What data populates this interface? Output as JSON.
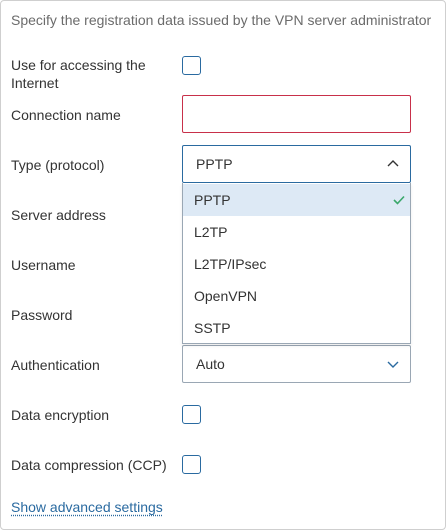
{
  "description": "Specify the registration data issued by the VPN server administrator",
  "form": {
    "internet_label": "Use for accessing the Internet",
    "connection_name_label": "Connection name",
    "connection_name_value": "",
    "type_label": "Type (protocol)",
    "type_value": "PPTP",
    "server_label": "Server address",
    "username_label": "Username",
    "password_label": "Password",
    "auth_label": "Authentication",
    "auth_value": "Auto",
    "encryption_label": "Data encryption",
    "compression_label": "Data compression (CCP)",
    "advanced_link": "Show advanced settings"
  },
  "dropdown": {
    "options": [
      "PPTP",
      "L2TP",
      "L2TP/IPsec",
      "OpenVPN",
      "SSTP"
    ],
    "selected_index": 0
  },
  "colors": {
    "accent": "#2a6aa0",
    "error": "#c8304a",
    "check": "#3aa86b",
    "selected_bg": "#dde9f5"
  },
  "icons": {
    "select_open": "chevron-up-icon",
    "select_closed": "chevron-down-icon",
    "selected_mark": "check-icon"
  }
}
